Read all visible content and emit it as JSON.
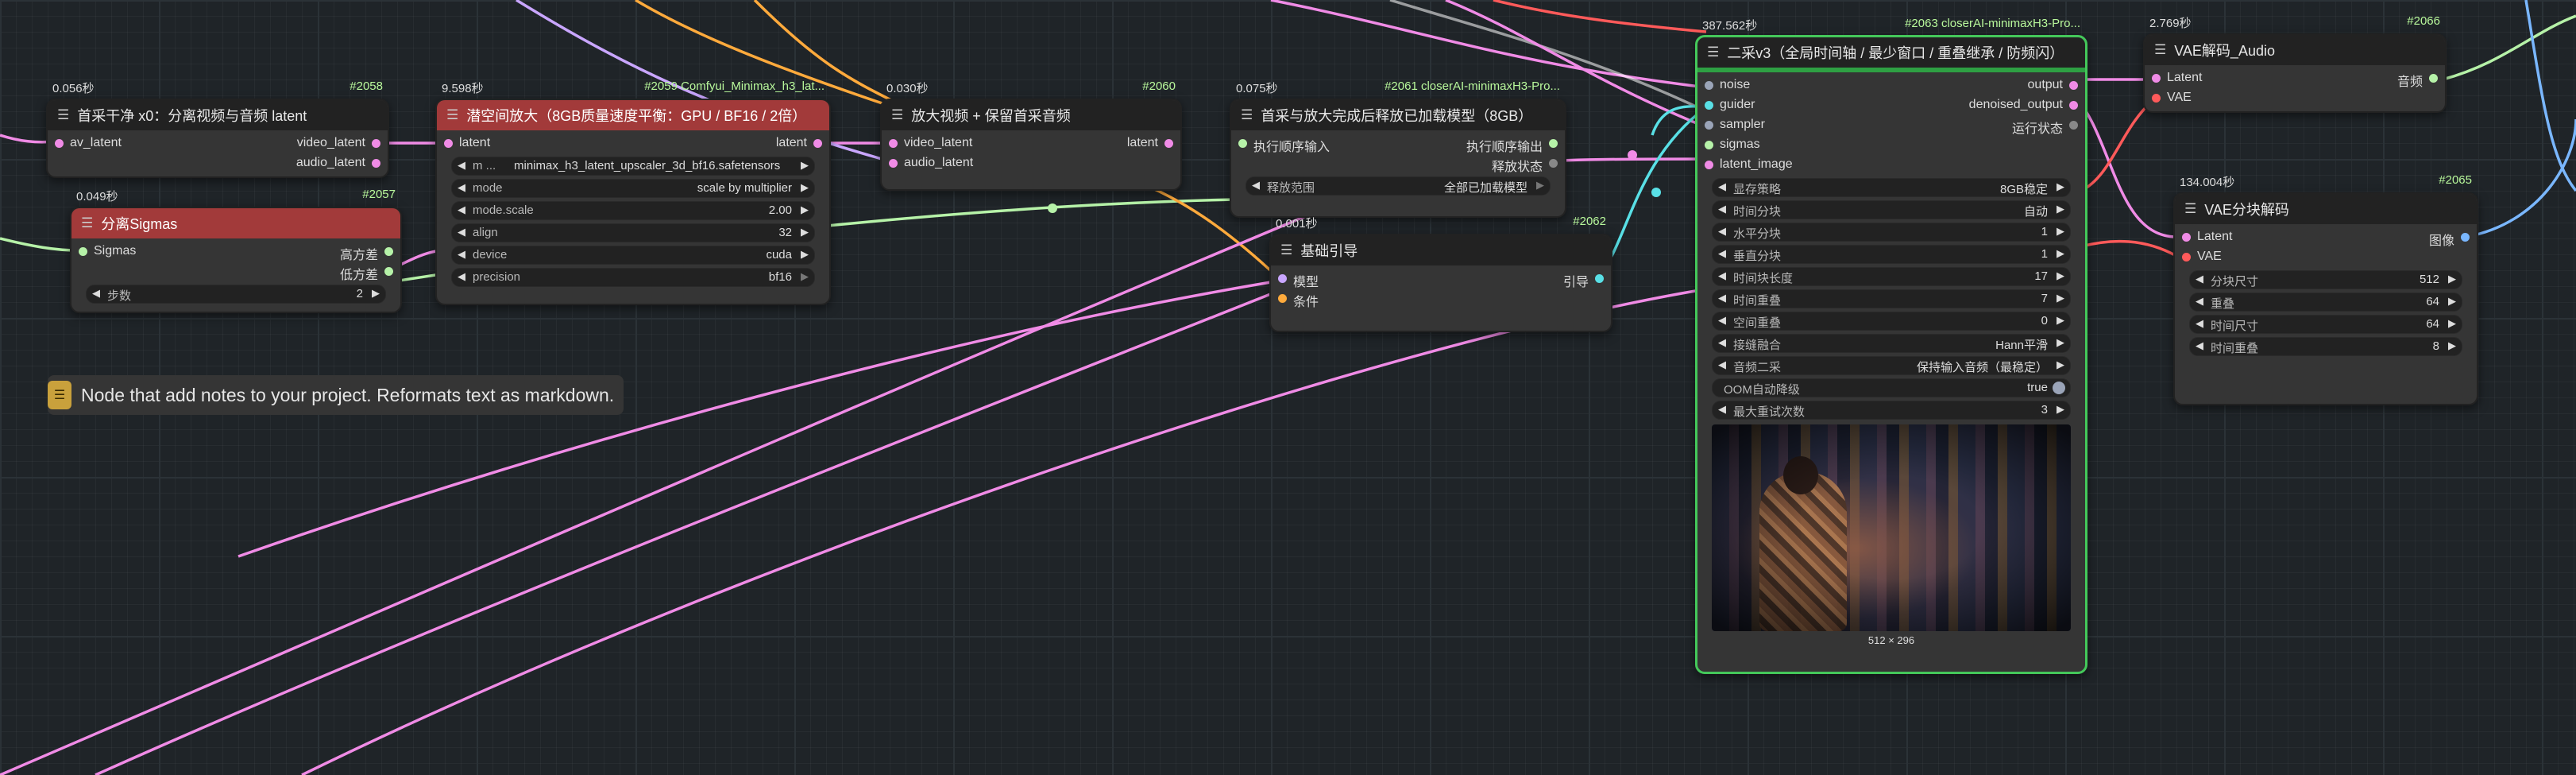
{
  "colors": {
    "selected_border": "#44c85a",
    "node_id": "#b8f89b",
    "red_header": "#a23a3a"
  },
  "nodes": {
    "n2058": {
      "time": "0.056秒",
      "id": "#2058",
      "title": "首采干净 x0：分离视频与音频 latent",
      "inputs": [
        "av_latent"
      ],
      "outputs": [
        "video_latent",
        "audio_latent"
      ]
    },
    "n2057": {
      "time": "0.049秒",
      "id": "#2057",
      "title": "分离Sigmas",
      "inputs": [
        "Sigmas"
      ],
      "outputs": [
        "高方差",
        "低方差"
      ],
      "widgets": [
        {
          "label": "步数",
          "value": "2"
        }
      ]
    },
    "n2059": {
      "time": "9.598秒",
      "id": "#2059 Comfyui_Minimax_h3_lat...",
      "title": "潜空间放大（8GB质量速度平衡：GPU / BF16 / 2倍）",
      "inputs": [
        "latent"
      ],
      "outputs": [
        "latent"
      ],
      "widgets": [
        {
          "label": "m ...",
          "value": "minimax_h3_latent_upscaler_3d_bf16.safetensors"
        },
        {
          "label": "mode",
          "value": "scale by multiplier"
        },
        {
          "label": "mode.scale",
          "value": "2.00"
        },
        {
          "label": "align",
          "value": "32"
        },
        {
          "label": "device",
          "value": "cuda"
        },
        {
          "label": "precision",
          "value": "bf16"
        }
      ]
    },
    "n2060": {
      "time": "0.030秒",
      "id": "#2060",
      "title": "放大视频 + 保留首采音频",
      "inputs": [
        "video_latent",
        "audio_latent"
      ],
      "outputs": [
        "latent"
      ]
    },
    "n2061": {
      "time": "0.075秒",
      "id": "#2061 closerAI-minimaxH3-Pro...",
      "title": "首采与放大完成后释放已加载模型（8GB）",
      "inputs": [
        "执行顺序输入"
      ],
      "outputs": [
        "执行顺序输出",
        "释放状态"
      ],
      "widgets": [
        {
          "label": "释放范围",
          "value": "全部已加载模型"
        }
      ]
    },
    "n2062": {
      "time": "0.001秒",
      "id": "#2062",
      "title": "基础引导",
      "inputs": [
        "模型",
        "条件"
      ],
      "outputs": [
        "引导"
      ]
    },
    "n2063": {
      "time": "387.562秒",
      "id": "#2063 closerAI-minimaxH3-Pro...",
      "title": "二采v3（全局时间轴 / 最少窗口 / 重叠继承 / 防频闪）",
      "inputs": [
        "noise",
        "guider",
        "sampler",
        "sigmas",
        "latent_image"
      ],
      "outputs": [
        "output",
        "denoised_output",
        "运行状态"
      ],
      "widgets": [
        {
          "label": "显存策略",
          "value": "8GB稳定"
        },
        {
          "label": "时间分块",
          "value": "自动"
        },
        {
          "label": "水平分块",
          "value": "1"
        },
        {
          "label": "垂直分块",
          "value": "1"
        },
        {
          "label": "时间块长度",
          "value": "17"
        },
        {
          "label": "时间重叠",
          "value": "7"
        },
        {
          "label": "空间重叠",
          "value": "0"
        },
        {
          "label": "接缝融合",
          "value": "Hann平滑"
        },
        {
          "label": "音频二采",
          "value": "保持输入音频（最稳定）"
        },
        {
          "label": "OOM自动降级",
          "value": "true"
        },
        {
          "label": "最大重试次数",
          "value": "3"
        }
      ],
      "preview_size": "512 × 296"
    },
    "n2066": {
      "time": "2.769秒",
      "id": "#2066",
      "title": "VAE解码_Audio",
      "inputs": [
        "Latent",
        "VAE"
      ],
      "outputs": [
        "音频"
      ]
    },
    "n2065": {
      "time": "134.004秒",
      "id": "#2065",
      "title": "VAE分块解码",
      "inputs": [
        "Latent",
        "VAE"
      ],
      "outputs": [
        "图像"
      ],
      "widgets": [
        {
          "label": "分块尺寸",
          "value": "512"
        },
        {
          "label": "重叠",
          "value": "64"
        },
        {
          "label": "时间尺寸",
          "value": "64"
        },
        {
          "label": "时间重叠",
          "value": "8"
        }
      ]
    }
  },
  "note": {
    "text": "Node that add notes to your project. Reformats text as markdown."
  }
}
